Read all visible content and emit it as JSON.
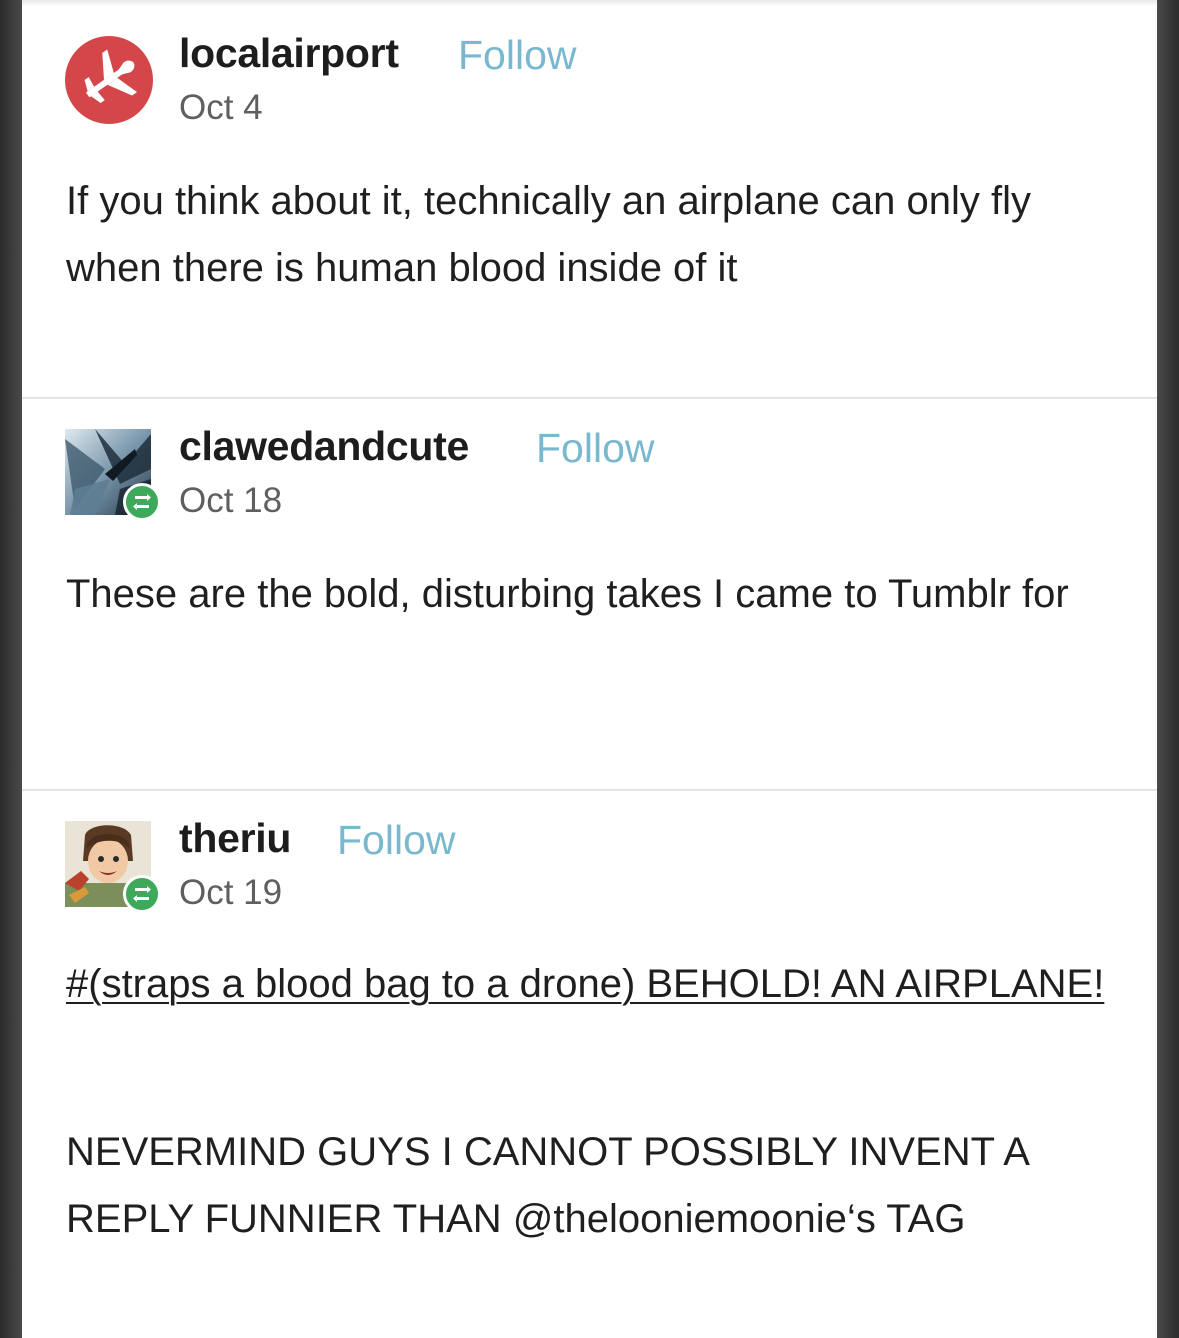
{
  "posts": [
    {
      "username": "localairport",
      "follow_label": "Follow",
      "date": "Oct 4",
      "avatar_icon": "airplane-icon",
      "body": "If you think about it, technically an airplane can only fly when there is human blood inside of it"
    },
    {
      "username": "clawedandcute",
      "follow_label": "Follow",
      "date": "Oct 18",
      "avatar_icon": "reblog-icon",
      "body": "These are the bold, disturbing takes I came to Tumblr for"
    },
    {
      "username": "theriu",
      "follow_label": "Follow",
      "date": "Oct 19",
      "avatar_icon": "reblog-icon",
      "tag": "#(straps a blood bag to a drone) BEHOLD! AN AIRPLANE!",
      "body_before_mention": "NEVERMIND GUYS I CANNOT POSSIBLY INVENT A REPLY FUNNIER THAN ",
      "mention": "@thelooniemoonie",
      "body_after_mention": "‘s TAG"
    }
  ],
  "colors": {
    "follow": "#79b8cf",
    "avatar_red": "#d5464a",
    "reblog_green": "#3ea95a",
    "text": "#1f1f1f",
    "date": "#5f5f5f"
  }
}
